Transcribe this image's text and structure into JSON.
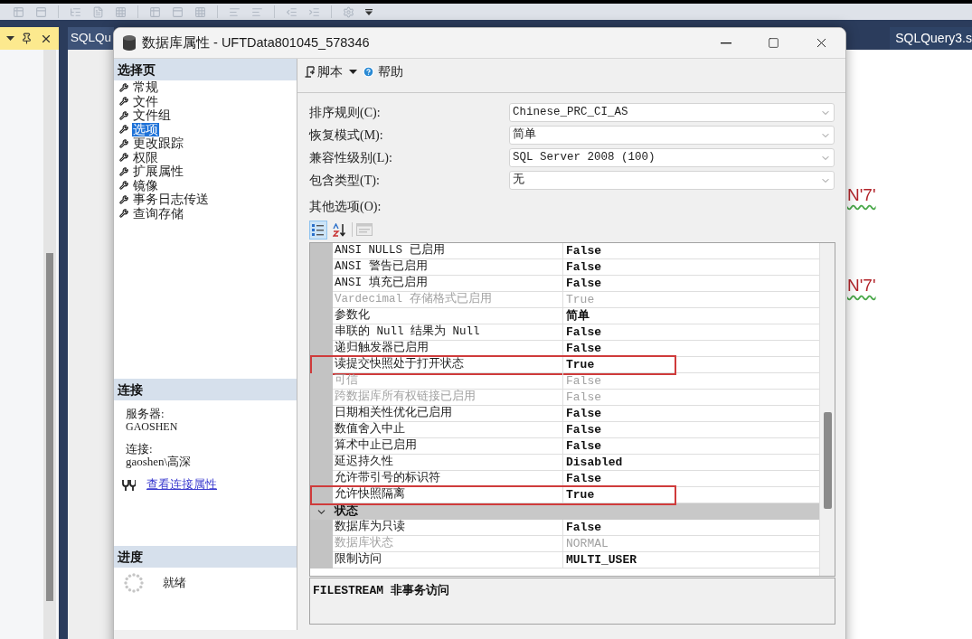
{
  "ide": {
    "editor_tabs": [
      {
        "label": "SQLQu"
      },
      {
        "label": "SQLQuery3.s"
      }
    ],
    "editor_lines": [
      {
        "text": "N'7'"
      },
      {
        "text": "N'7'"
      }
    ]
  },
  "dialog": {
    "title": "数据库属性 - UFTData801045_578346",
    "select_page": {
      "heading": "选择页",
      "items": [
        {
          "label": "常规",
          "selected": false
        },
        {
          "label": "文件",
          "selected": false
        },
        {
          "label": "文件组",
          "selected": false
        },
        {
          "label": "选项",
          "selected": true
        },
        {
          "label": "更改跟踪",
          "selected": false
        },
        {
          "label": "权限",
          "selected": false
        },
        {
          "label": "扩展属性",
          "selected": false
        },
        {
          "label": "镜像",
          "selected": false
        },
        {
          "label": "事务日志传送",
          "selected": false
        },
        {
          "label": "查询存储",
          "selected": false
        }
      ]
    },
    "connection": {
      "heading": "连接",
      "server_label": "服务器:",
      "server": "GAOSHEN",
      "connection_label": "连接:",
      "connection": "gaoshen\\高深",
      "link": "查看连接属性"
    },
    "progress": {
      "heading": "进度",
      "status": "就绪"
    },
    "toolbar": {
      "script": "脚本",
      "help": "帮助"
    },
    "fields": [
      {
        "label": "排序规则(C):",
        "value": "Chinese_PRC_CI_AS"
      },
      {
        "label": "恢复模式(M):",
        "value": "简单"
      },
      {
        "label": "兼容性级别(L):",
        "value": "SQL Server 2008 (100)"
      },
      {
        "label": "包含类型(T):",
        "value": "无"
      }
    ],
    "other_options_label": "其他选项(O):",
    "grid": {
      "view_modes": [
        {
          "kind": "categorized",
          "selected": true
        },
        {
          "kind": "alphabetical",
          "selected": false
        }
      ],
      "property_pages": {
        "disabled": true
      },
      "rows": [
        {
          "kind": "property",
          "name": "ANSI NULLS 已启用",
          "value": "False",
          "disabled": false,
          "highlighted": false
        },
        {
          "kind": "property",
          "name": "ANSI 警告已启用",
          "value": "False",
          "disabled": false,
          "highlighted": false
        },
        {
          "kind": "property",
          "name": "ANSI 填充已启用",
          "value": "False",
          "disabled": false,
          "highlighted": false
        },
        {
          "kind": "property",
          "name": "Vardecimal 存储格式已启用",
          "value": "True",
          "disabled": true,
          "highlighted": false
        },
        {
          "kind": "property",
          "name": "参数化",
          "value": "简单",
          "disabled": false,
          "highlighted": false
        },
        {
          "kind": "property",
          "name": "串联的 Null 结果为 Null",
          "value": "False",
          "disabled": false,
          "highlighted": false
        },
        {
          "kind": "property",
          "name": "递归触发器已启用",
          "value": "False",
          "disabled": false,
          "highlighted": false
        },
        {
          "kind": "property",
          "name": "读提交快照处于打开状态",
          "value": "True",
          "disabled": false,
          "highlighted": true
        },
        {
          "kind": "property",
          "name": "可信",
          "value": "False",
          "disabled": true,
          "highlighted": false
        },
        {
          "kind": "property",
          "name": "跨数据库所有权链接已启用",
          "value": "False",
          "disabled": true,
          "highlighted": false
        },
        {
          "kind": "property",
          "name": "日期相关性优化已启用",
          "value": "False",
          "disabled": false,
          "highlighted": false
        },
        {
          "kind": "property",
          "name": "数值舍入中止",
          "value": "False",
          "disabled": false,
          "highlighted": false
        },
        {
          "kind": "property",
          "name": "算术中止已启用",
          "value": "False",
          "disabled": false,
          "highlighted": false
        },
        {
          "kind": "property",
          "name": "延迟持久性",
          "value": "Disabled",
          "disabled": false,
          "highlighted": false
        },
        {
          "kind": "property",
          "name": "允许带引号的标识符",
          "value": "False",
          "disabled": false,
          "highlighted": false
        },
        {
          "kind": "property",
          "name": "允许快照隔离",
          "value": "True",
          "disabled": false,
          "highlighted": true
        },
        {
          "kind": "category",
          "name": "状态",
          "expanded": true
        },
        {
          "kind": "property",
          "name": "数据库为只读",
          "value": "False",
          "disabled": false,
          "highlighted": false
        },
        {
          "kind": "property",
          "name": "数据库状态",
          "value": "NORMAL",
          "disabled": true,
          "highlighted": false
        },
        {
          "kind": "property",
          "name": "限制访问",
          "value": "MULTI_USER",
          "disabled": false,
          "highlighted": false
        }
      ]
    },
    "description": "FILESTREAM 非事务访问"
  }
}
